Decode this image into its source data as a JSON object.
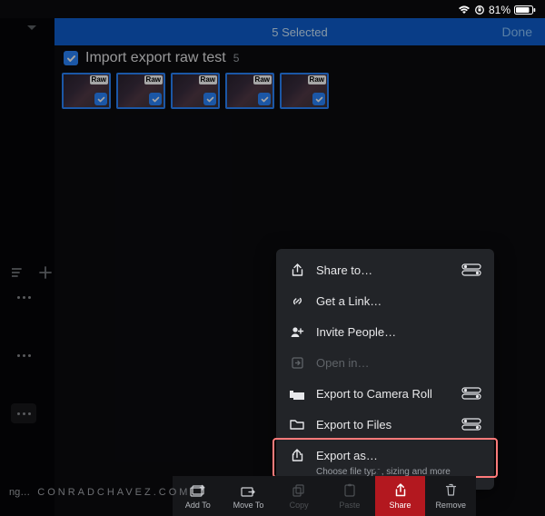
{
  "status": {
    "battery_pct": "81%",
    "wifi": true,
    "rotation_lock": true
  },
  "selection_bar": {
    "count_label": "5 Selected",
    "done_label": "Done"
  },
  "collection": {
    "title": "Import export raw test",
    "count": "5",
    "raw_badge": "Raw"
  },
  "share_menu": {
    "items": [
      {
        "label": "Share to…"
      },
      {
        "label": "Get a Link…"
      },
      {
        "label": "Invite People…"
      },
      {
        "label": "Open in…",
        "disabled": true
      },
      {
        "label": "Export to Camera Roll"
      },
      {
        "label": "Export to Files"
      },
      {
        "label": "Export as…",
        "sub": "Choose file type, sizing and more"
      }
    ]
  },
  "toolbar": {
    "items": [
      "Add To",
      "Move To",
      "Copy",
      "Paste",
      "Share",
      "Remove"
    ]
  },
  "watermark": "CONRADCHAVEZ.COM",
  "truncated_text": "ng…"
}
